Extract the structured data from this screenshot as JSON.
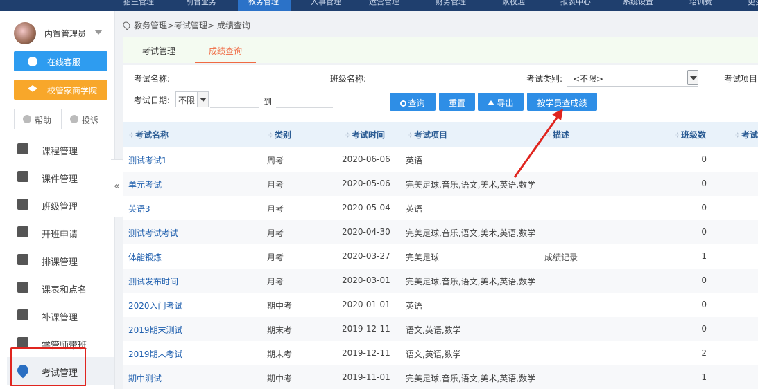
{
  "topnav": {
    "items": [
      "招生管理",
      "前台业务",
      "教务管理",
      "人事管理",
      "运营管理",
      "财务管理",
      "家校通",
      "报表中心",
      "系统设置",
      "培训费",
      "更多"
    ],
    "active_index": 2
  },
  "sidebar": {
    "user_name": "内置管理员",
    "online_service": "在线客服",
    "academy": "校管家商学院",
    "help": "帮助",
    "complaint": "投诉",
    "collapse_icon": "«",
    "items": [
      {
        "label": "课程管理",
        "icon": "course-icon"
      },
      {
        "label": "课件管理",
        "icon": "courseware-icon"
      },
      {
        "label": "班级管理",
        "icon": "class-icon"
      },
      {
        "label": "开班申请",
        "icon": "apply-icon"
      },
      {
        "label": "排课管理",
        "icon": "calendar-icon"
      },
      {
        "label": "课表和点名",
        "icon": "rollcall-icon"
      },
      {
        "label": "补课管理",
        "icon": "makeup-icon"
      },
      {
        "label": "学管师带班",
        "icon": "teacher-icon"
      },
      {
        "label": "考试管理",
        "icon": "exam-icon"
      }
    ],
    "active_index": 8
  },
  "breadcrumb": "教务管理>考试管理> 成绩查询",
  "tabs": [
    {
      "label": "考试管理"
    },
    {
      "label": "成绩查询"
    }
  ],
  "active_tab": 1,
  "filters": {
    "exam_name_label": "考试名称:",
    "class_name_label": "班级名称:",
    "exam_type_label": "考试类别:",
    "exam_type_value": "<不限>",
    "exam_item_label": "考试项目",
    "exam_date_label": "考试日期:",
    "exam_date_value": "不限",
    "to_label": "到"
  },
  "buttons": {
    "query": "查询",
    "reset": "重置",
    "export": "导出",
    "by_student": "按学员查成绩"
  },
  "table": {
    "columns": [
      "考试名称",
      "类别",
      "考试时间",
      "考试项目",
      "描述",
      "班级数",
      "考试"
    ],
    "rows": [
      {
        "name": "测试考试1",
        "type": "周考",
        "date": "2020-06-06",
        "items": "英语",
        "desc": "",
        "classes": "0"
      },
      {
        "name": "单元考试",
        "type": "月考",
        "date": "2020-05-06",
        "items": "完美足球,音乐,语文,美术,英语,数学",
        "desc": "",
        "classes": "0"
      },
      {
        "name": "英语3",
        "type": "月考",
        "date": "2020-05-04",
        "items": "英语",
        "desc": "",
        "classes": "0"
      },
      {
        "name": "测试考试考试",
        "type": "月考",
        "date": "2020-04-30",
        "items": "完美足球,音乐,语文,美术,英语,数学",
        "desc": "",
        "classes": "0"
      },
      {
        "name": "体能锻炼",
        "type": "月考",
        "date": "2020-03-27",
        "items": "完美足球",
        "desc": "成绩记录",
        "classes": "1"
      },
      {
        "name": "测试发布时间",
        "type": "月考",
        "date": "2020-03-01",
        "items": "完美足球,音乐,语文,美术,英语,数学",
        "desc": "",
        "classes": "0"
      },
      {
        "name": "2020入门考试",
        "type": "期中考",
        "date": "2020-01-01",
        "items": "英语",
        "desc": "",
        "classes": "0"
      },
      {
        "name": "2019期末测试",
        "type": "期末考",
        "date": "2019-12-11",
        "items": "语文,英语,数学",
        "desc": "",
        "classes": "0"
      },
      {
        "name": "2019期末考试",
        "type": "期末考",
        "date": "2019-12-11",
        "items": "语文,英语,数学",
        "desc": "",
        "classes": "2"
      },
      {
        "name": "期中测试",
        "type": "期中考",
        "date": "2019-11-01",
        "items": "完美足球,音乐,语文,美术,英语,数学",
        "desc": "",
        "classes": "1"
      }
    ]
  },
  "colors": {
    "accent_blue": "#2e8ee6",
    "tab_active": "#f06a43",
    "annotation_red": "#e0251f",
    "link": "#1f5fae"
  }
}
